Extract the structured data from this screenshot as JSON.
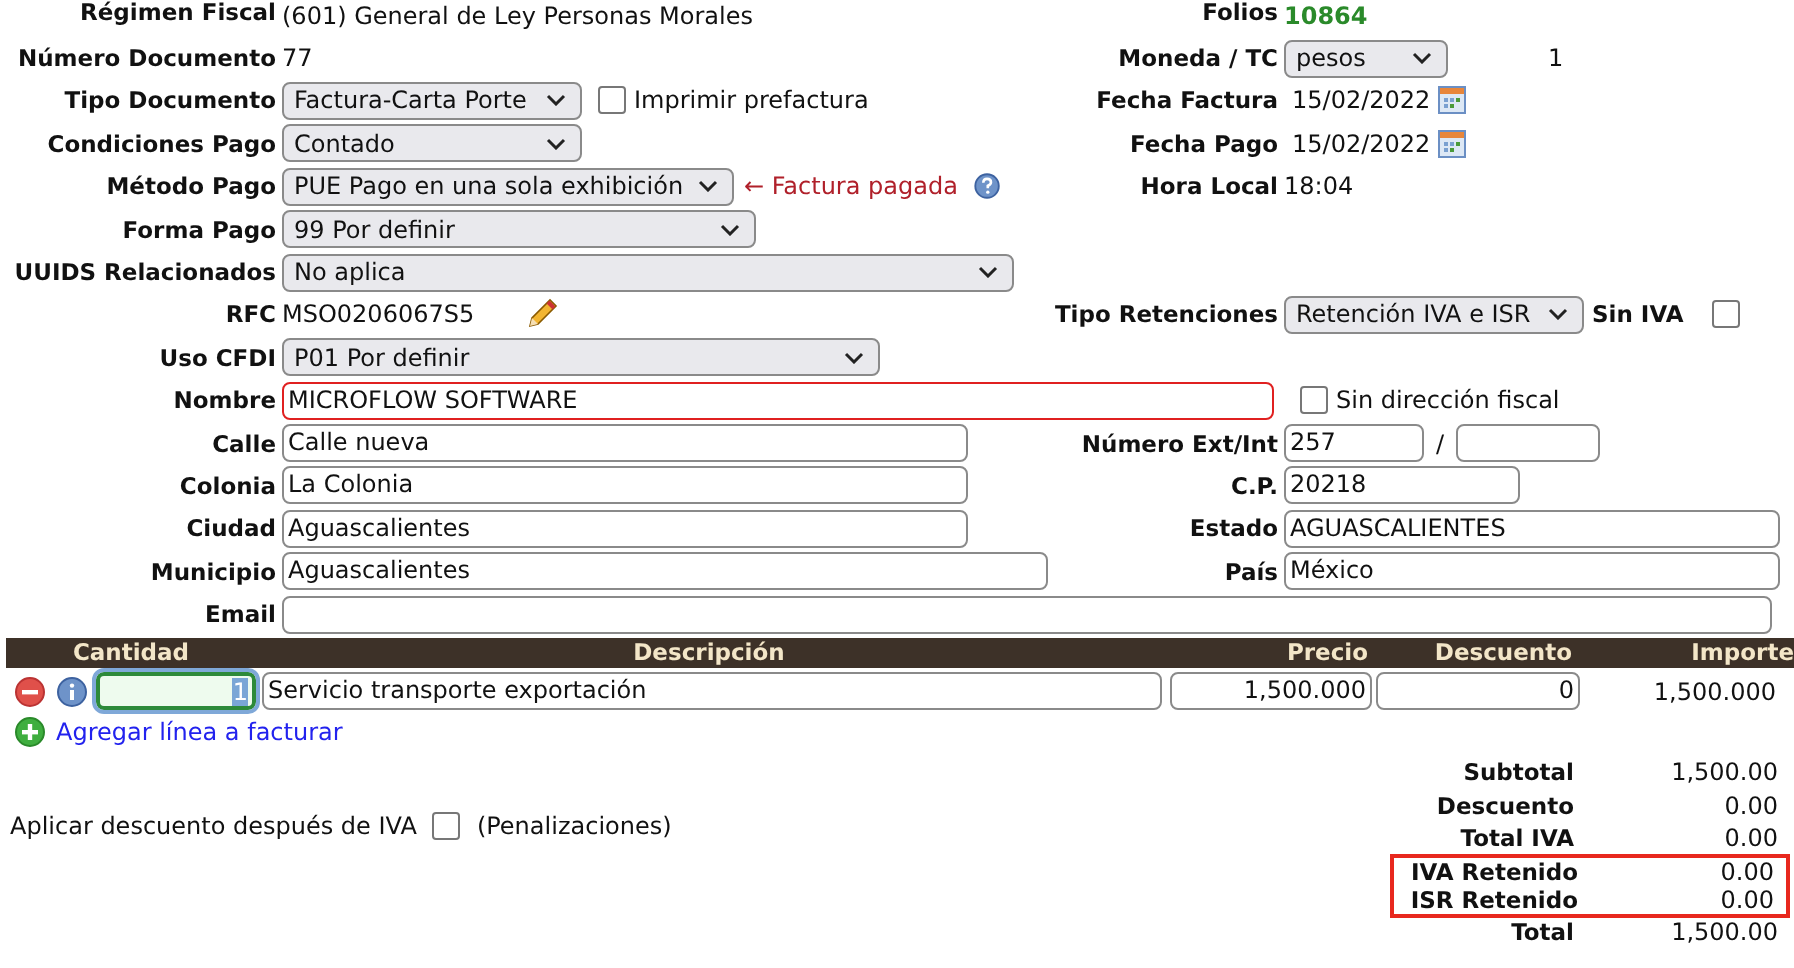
{
  "header": {
    "left": {
      "label": "Régimen Fiscal",
      "value": "(601) General de Ley Personas Morales"
    },
    "right": {
      "label": "Folios",
      "value": "10864"
    }
  },
  "rows": [
    {
      "left": {
        "label": "Número Documento",
        "kind": "text",
        "value": "77"
      },
      "right": {
        "label": "Moneda / TC",
        "kind": "select",
        "value": "pesos",
        "extra": "1"
      }
    },
    {
      "left": {
        "label": "Tipo Documento",
        "kind": "select",
        "value": "Factura-Carta Porte",
        "checkbox": {
          "text": "Imprimir prefactura",
          "checked": false
        }
      },
      "right": {
        "label": "Fecha Factura",
        "kind": "date",
        "value": "15/02/2022"
      }
    },
    {
      "left": {
        "label": "Condiciones Pago",
        "kind": "select",
        "value": "Contado"
      },
      "right": {
        "label": "Fecha Pago",
        "kind": "date",
        "value": "15/02/2022"
      }
    },
    {
      "left": {
        "label": "Método Pago",
        "kind": "select",
        "value": "PUE Pago en una sola exhibición",
        "note": "← Factura pagada"
      },
      "right": {
        "label": "Hora Local",
        "kind": "text",
        "value": "18:04"
      }
    },
    {
      "left": {
        "label": "Forma Pago",
        "kind": "select",
        "value": "99 Por definir"
      }
    },
    {
      "left": {
        "label": "UUIDS Relacionados",
        "kind": "select",
        "value": "No aplica"
      }
    },
    {
      "left": {
        "label": "RFC",
        "kind": "editable-text",
        "value": "MSO0206067S5"
      },
      "right": {
        "label": "Tipo Retenciones",
        "kind": "select",
        "value": "Retención IVA e ISR",
        "checkbox": {
          "text": "Sin IVA",
          "checked": false
        }
      }
    },
    {
      "left": {
        "label": "Uso CFDI",
        "kind": "select",
        "value": "P01 Por definir"
      }
    },
    {
      "left": {
        "label": "Nombre",
        "kind": "input",
        "value": "MICROFLOW SOFTWARE",
        "invalid": true
      },
      "right": {
        "kind": "checkbox",
        "text": "Sin dirección fiscal",
        "checked": false
      }
    },
    {
      "left": {
        "label": "Calle",
        "kind": "input",
        "value": "Calle nueva",
        "invalid": false
      },
      "right": {
        "label": "Número Ext/Int",
        "kind": "input-pair",
        "value": "257",
        "separator": "/"
      }
    },
    {
      "left": {
        "label": "Colonia",
        "kind": "input",
        "value": "La Colonia",
        "invalid": false
      },
      "right": {
        "label": "C.P.",
        "kind": "input",
        "value": "20218",
        "invalid": false
      }
    },
    {
      "left": {
        "label": "Ciudad",
        "kind": "input",
        "value": "Aguascalientes",
        "invalid": false
      },
      "right": {
        "label": "Estado",
        "kind": "input",
        "value": "AGUASCALIENTES",
        "invalid": false
      }
    },
    {
      "left": {
        "label": "Municipio",
        "kind": "input",
        "value": "Aguascalientes",
        "invalid": false
      },
      "right": {
        "label": "País",
        "kind": "input",
        "value": "México",
        "invalid": false
      }
    },
    {
      "left": {
        "label": "Email",
        "kind": "input",
        "invalid": false
      }
    }
  ],
  "table": {
    "columns": [
      "Cantidad",
      "Descripción",
      "Precio",
      "Descuento",
      "Importe"
    ],
    "rows": [
      {
        "cantidad": "1",
        "focused": true,
        "descripcion": "Servicio transporte exportación",
        "precio": "1,500.000",
        "descuento": "0",
        "importe": "1,500.000"
      }
    ]
  },
  "add_line": "Agregar línea a facturar",
  "discount_option": {
    "text": "Aplicar descuento después de IVA",
    "checked": false,
    "note": "(Penalizaciones)"
  },
  "totals": [
    {
      "label": "Subtotal",
      "value": "1,500.00",
      "highlighted": false
    },
    {
      "label": "Descuento",
      "value": "0.00",
      "highlighted": false
    },
    {
      "label": "Total IVA",
      "value": "0.00",
      "highlighted": false
    },
    {
      "label": "IVA Retenido",
      "value": "0.00",
      "highlighted": true
    },
    {
      "label": "ISR Retenido",
      "value": "0.00",
      "highlighted": true
    },
    {
      "label": "Total",
      "value": "1,500.00",
      "highlighted": false
    }
  ]
}
